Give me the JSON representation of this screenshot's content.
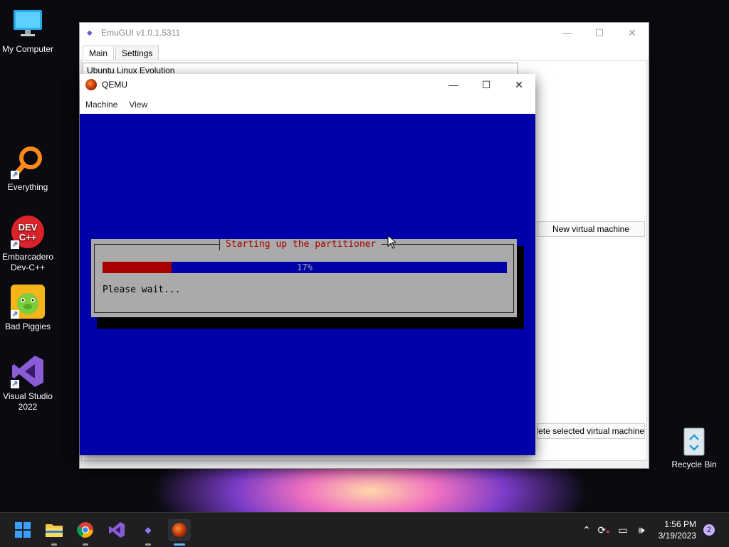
{
  "desktop": {
    "icons": [
      {
        "label": "My Computer",
        "icon": "monitor-icon"
      },
      {
        "label": "Everything",
        "icon": "magnifier-icon"
      },
      {
        "label": "Embarcadero Dev-C++",
        "line1": "Embarcadero",
        "line2": "Dev-C++",
        "badge": "DEV C++",
        "icon": "devcpp-icon"
      },
      {
        "label": "Bad Piggies",
        "icon": "bad-piggies-icon"
      },
      {
        "label": "Visual Studio 2022",
        "line1": "Visual Studio",
        "line2": "2022",
        "icon": "visual-studio-icon"
      }
    ],
    "recycle_bin": "Recycle Bin"
  },
  "emugui": {
    "title": "EmuGUI v1.0.1.5311",
    "tabs": [
      "Main",
      "Settings"
    ],
    "active_tab": "Main",
    "vm_list": [
      "Ubuntu Linux Evolution"
    ],
    "buttons": {
      "new_vm": "New virtual machine",
      "delete_vm": "Delete selected virtual machine"
    }
  },
  "qemu": {
    "title": "QEMU",
    "menus": [
      "Machine",
      "View"
    ],
    "dialog": {
      "title": "Starting up the partitioner",
      "progress_percent": 17,
      "progress_label": "17%",
      "message": "Please wait..."
    },
    "colors": {
      "screen": "#0000a8",
      "dialog": "#aaaaaa",
      "accent": "#a80000"
    }
  },
  "taskbar": {
    "apps": [
      "start-icon",
      "file-explorer-icon",
      "chrome-icon",
      "visual-studio-icon",
      "emugui-icon",
      "qemu-icon"
    ],
    "time": "1:56 PM",
    "date": "3/19/2023",
    "notifications": "2"
  }
}
